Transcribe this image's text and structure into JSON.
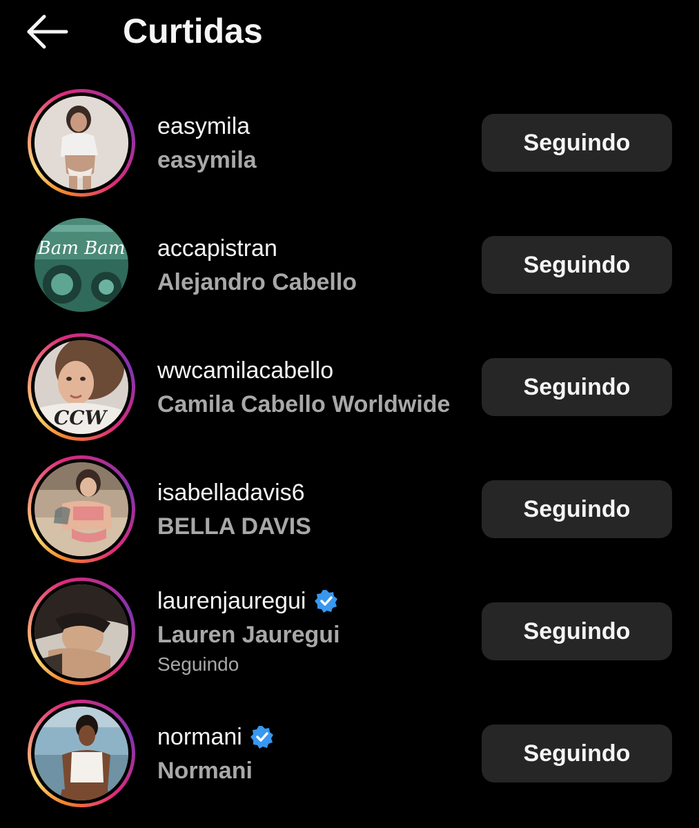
{
  "header": {
    "back_icon": "arrow-left-icon",
    "title": "Curtidas"
  },
  "users": [
    {
      "username": "easymila",
      "fullname": "easymila",
      "subtext": "",
      "verified": false,
      "story_ring": true,
      "button_label": "Seguindo"
    },
    {
      "username": "accapistran",
      "fullname": "Alejandro Cabello",
      "subtext": "",
      "verified": false,
      "story_ring": false,
      "button_label": "Seguindo"
    },
    {
      "username": "wwcamilacabello",
      "fullname": "Camila Cabello Worldwide",
      "subtext": "",
      "verified": false,
      "story_ring": true,
      "button_label": "Seguindo"
    },
    {
      "username": "isabelladavis6",
      "fullname": "BELLA DAVIS",
      "subtext": "",
      "verified": false,
      "story_ring": true,
      "button_label": "Seguindo"
    },
    {
      "username": "laurenjauregui",
      "fullname": "Lauren Jauregui",
      "subtext": "Seguindo",
      "verified": true,
      "story_ring": true,
      "button_label": "Seguindo"
    },
    {
      "username": "normani",
      "fullname": "Normani",
      "subtext": "",
      "verified": true,
      "story_ring": true,
      "button_label": "Seguindo"
    }
  ],
  "colors": {
    "background": "#000000",
    "button_bg": "#262626",
    "secondary_text": "#a8a8a8",
    "verified_blue": "#3897f0"
  },
  "avatar_text": {
    "accapistran": "Bam Bam",
    "wwcamilacabello": "CCW"
  }
}
